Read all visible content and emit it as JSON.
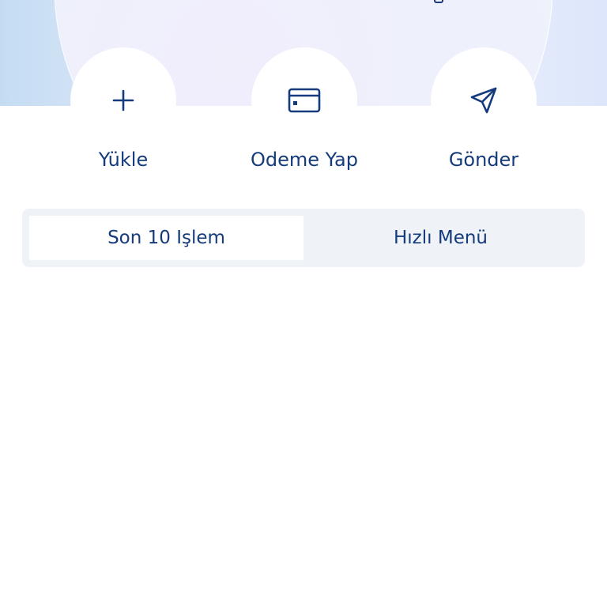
{
  "colors": {
    "primary": "#153b7c",
    "segment_bg": "#eff3f8",
    "white": "#ffffff"
  },
  "actions": [
    {
      "label": "Yükle",
      "icon": "plus-icon"
    },
    {
      "label": "Odeme Yap",
      "icon": "credit-card-icon"
    },
    {
      "label": "Gönder",
      "icon": "send-icon"
    }
  ],
  "tabs": {
    "active_label": "Son 10 Işlem",
    "inactive_label": "Hızlı Menü",
    "selected": "Son 10 Işlem"
  }
}
